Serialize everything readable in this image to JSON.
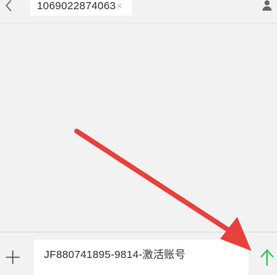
{
  "header": {
    "recipient": "1069022874063",
    "remove_glyph": "×",
    "back_icon": "chevron-left-icon",
    "contact_icon": "person-icon"
  },
  "compose": {
    "message": "JF880741895-9814-激活账号",
    "attach_icon": "plus-icon",
    "send_icon": "arrow-up-icon"
  },
  "colors": {
    "background": "#f2f2f2",
    "send_accent": "#3cc560",
    "annotation": "#e8403a"
  }
}
